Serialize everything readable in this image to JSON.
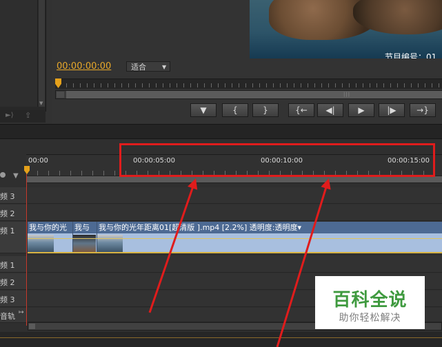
{
  "program_monitor": {
    "overlay_text": "节目编号：01",
    "timecode": "00:00:00:00",
    "fit_label": "适合"
  },
  "transport": {
    "marker_btn": "▼",
    "in_btn": "{",
    "out_btn": "}",
    "go_in_btn": "{←",
    "step_back_btn": "◀|",
    "play_btn": "▶",
    "step_fwd_btn": "|▶",
    "go_out_btn": "→}"
  },
  "timeline": {
    "time_labels": [
      "00:00",
      "00:00:05:00",
      "00:00:10:00",
      "00:00:15:00"
    ],
    "tracks": {
      "video3": "频 3",
      "video2": "频 2",
      "video1": "频 1",
      "audio1": "频 1",
      "audio2": "频 2",
      "audio3": "频 3",
      "master": "音轨"
    },
    "clips": [
      {
        "label": "我与你的光"
      },
      {
        "label": "我与"
      },
      {
        "label": "我与你的光年距离01[超清版 ].mp4 [2.2%] 透明度:透明度▾"
      }
    ]
  },
  "watermark": {
    "title": "百科全说",
    "subtitle": "助你轻松解决"
  },
  "icons": {
    "snap": "snap-icon",
    "marker": "marker-icon",
    "nav_back": "nav-back-icon",
    "nav_export": "export-icon"
  },
  "colors": {
    "accent_orange": "#e9a92a",
    "annotation_red": "#e01c1c",
    "clip_blue": "#4d6a93",
    "watermark_green": "#3f9a3f"
  }
}
